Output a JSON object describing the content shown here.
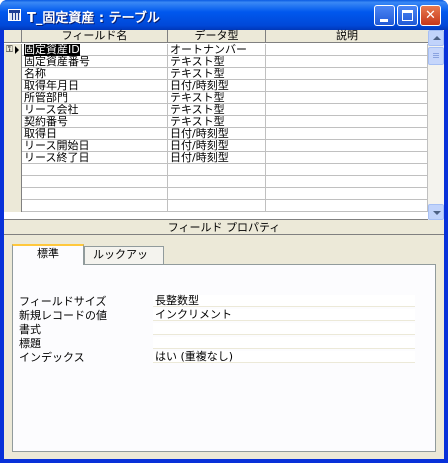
{
  "window": {
    "title": "T_固定資産 : テーブル",
    "minimize_icon": "minimize-icon",
    "maximize_icon": "maximize-icon",
    "close_glyph": "✕"
  },
  "grid": {
    "headers": [
      "フィールド名",
      "データ型",
      "説明"
    ],
    "rows": [
      {
        "name": "固定資産ID",
        "type": "オートナンバー",
        "desc": "",
        "primary_key": true,
        "selected": true
      },
      {
        "name": "固定資産番号",
        "type": "テキスト型",
        "desc": ""
      },
      {
        "name": "名称",
        "type": "テキスト型",
        "desc": ""
      },
      {
        "name": "取得年月日",
        "type": "日付/時刻型",
        "desc": ""
      },
      {
        "name": "所管部門",
        "type": "テキスト型",
        "desc": ""
      },
      {
        "name": "リース会社",
        "type": "テキスト型",
        "desc": ""
      },
      {
        "name": "契約番号",
        "type": "テキスト型",
        "desc": ""
      },
      {
        "name": "取得日",
        "type": "日付/時刻型",
        "desc": ""
      },
      {
        "name": "リース開始日",
        "type": "日付/時刻型",
        "desc": ""
      },
      {
        "name": "リース終了日",
        "type": "日付/時刻型",
        "desc": ""
      },
      {
        "name": "",
        "type": "",
        "desc": ""
      },
      {
        "name": "",
        "type": "",
        "desc": ""
      },
      {
        "name": "",
        "type": "",
        "desc": ""
      },
      {
        "name": "",
        "type": "",
        "desc": ""
      }
    ]
  },
  "properties": {
    "section_title": "フィールド プロパティ",
    "tabs": [
      {
        "label": "標準",
        "active": true
      },
      {
        "label": "ルックアップ",
        "active": false
      }
    ],
    "fields": [
      {
        "label": "フィールドサイズ",
        "value": "長整数型"
      },
      {
        "label": "新規レコードの値",
        "value": "インクリメント"
      },
      {
        "label": "書式",
        "value": ""
      },
      {
        "label": "標題",
        "value": ""
      },
      {
        "label": "インデックス",
        "value": "はい (重複なし)"
      }
    ]
  },
  "colors": {
    "titlebar": "#0058ee",
    "frame": "#0831d9",
    "face": "#ece9d8"
  }
}
